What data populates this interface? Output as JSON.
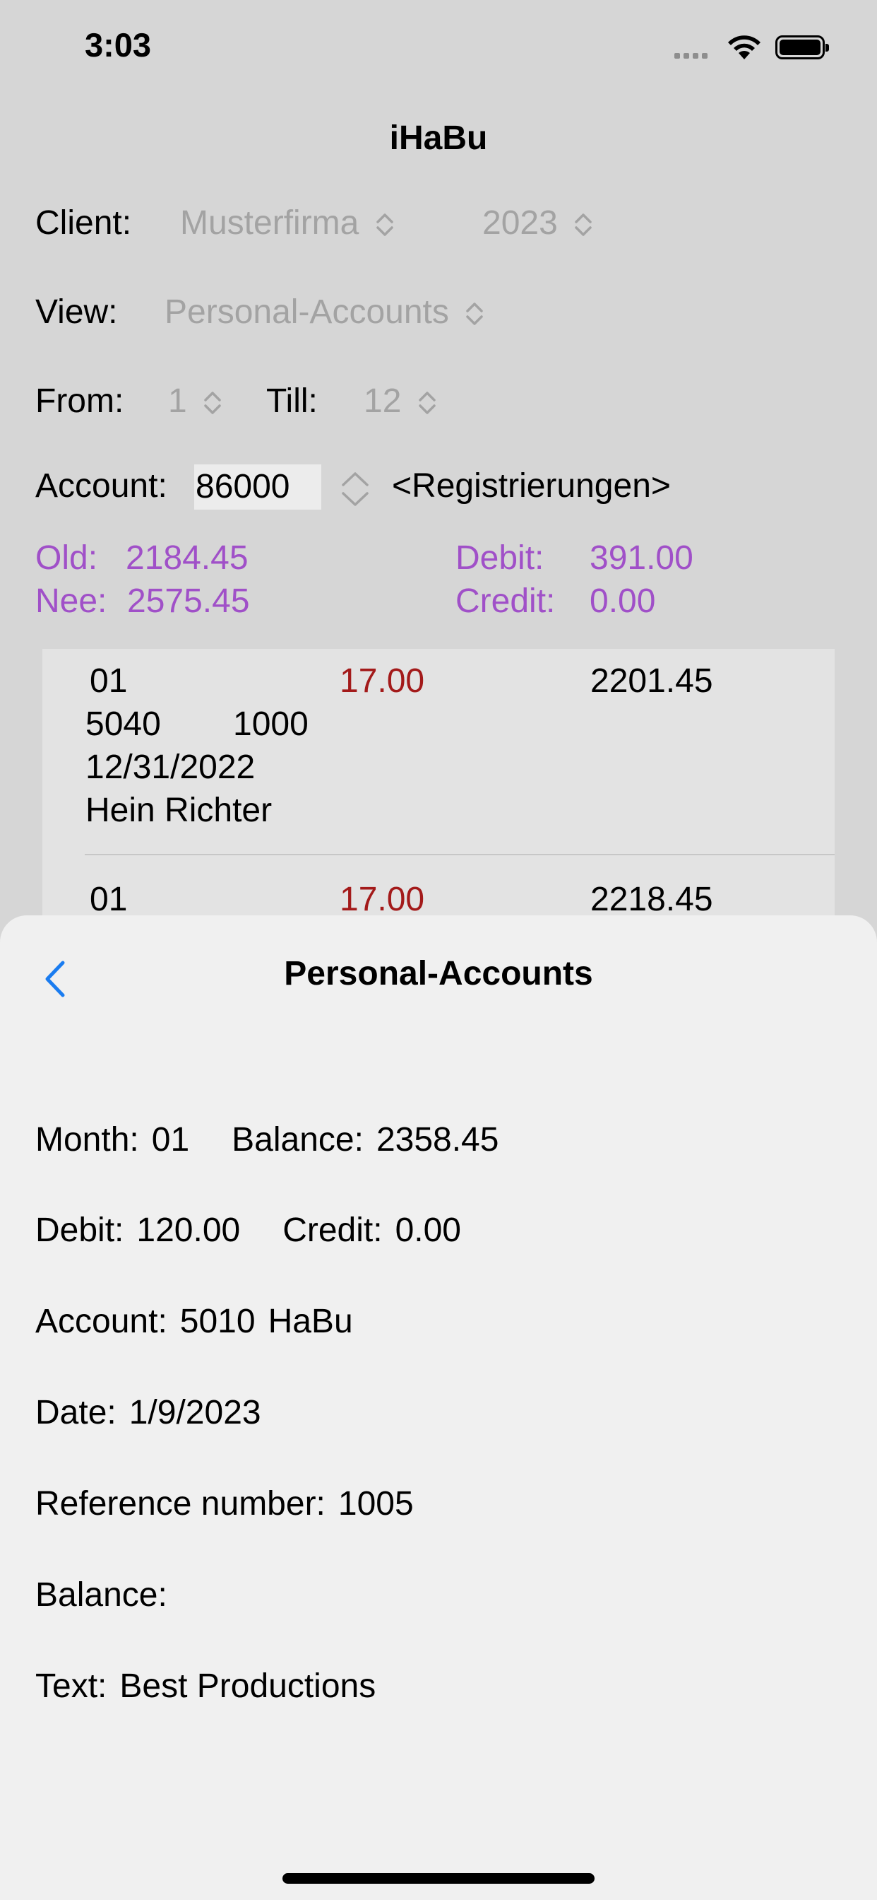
{
  "status": {
    "time": "3:03"
  },
  "app": {
    "title": "iHaBu"
  },
  "client": {
    "label": "Client:",
    "company": "Musterfirma",
    "year": "2023"
  },
  "view": {
    "label": "View:",
    "value": "Personal-Accounts"
  },
  "range": {
    "from_label": "From:",
    "from_value": "1",
    "till_label": "Till:",
    "till_value": "12"
  },
  "account": {
    "label": "Account:",
    "number": "86000",
    "name": "<Registrierungen>"
  },
  "summary": {
    "old_label": "Old:",
    "old_value": "2184.45",
    "new_label": "Nee:",
    "new_value": "2575.45",
    "debit_label": "Debit:",
    "debit_value": "391.00",
    "credit_label": "Credit:",
    "credit_value": "0.00"
  },
  "entries": [
    {
      "month": "01",
      "amount": "17.00",
      "balance": "2201.45",
      "account": "5040",
      "contra": "1000",
      "date": "12/31/2022",
      "text": "Hein Richter"
    },
    {
      "month": "01",
      "amount": "17.00",
      "balance": "2218.45"
    }
  ],
  "sheet": {
    "title": "Personal-Accounts",
    "month_label": "Month:",
    "month_value": "01",
    "balance_label": "Balance:",
    "balance_value": "2358.45",
    "debit_label": "Debit:",
    "debit_value": "120.00",
    "credit_label": "Credit:",
    "credit_value": "0.00",
    "account_label": "Account:",
    "account_number": "5010",
    "account_name": "HaBu",
    "date_label": "Date:",
    "date_value": "1/9/2023",
    "ref_label": "Reference number:",
    "ref_value": "1005",
    "balance2_label": "Balance:",
    "balance2_value": "",
    "text_label": "Text:",
    "text_value": "Best Productions"
  },
  "colors": {
    "accent": "#1a7cf0",
    "purple": "#a050c8",
    "red": "#a31a1a"
  }
}
